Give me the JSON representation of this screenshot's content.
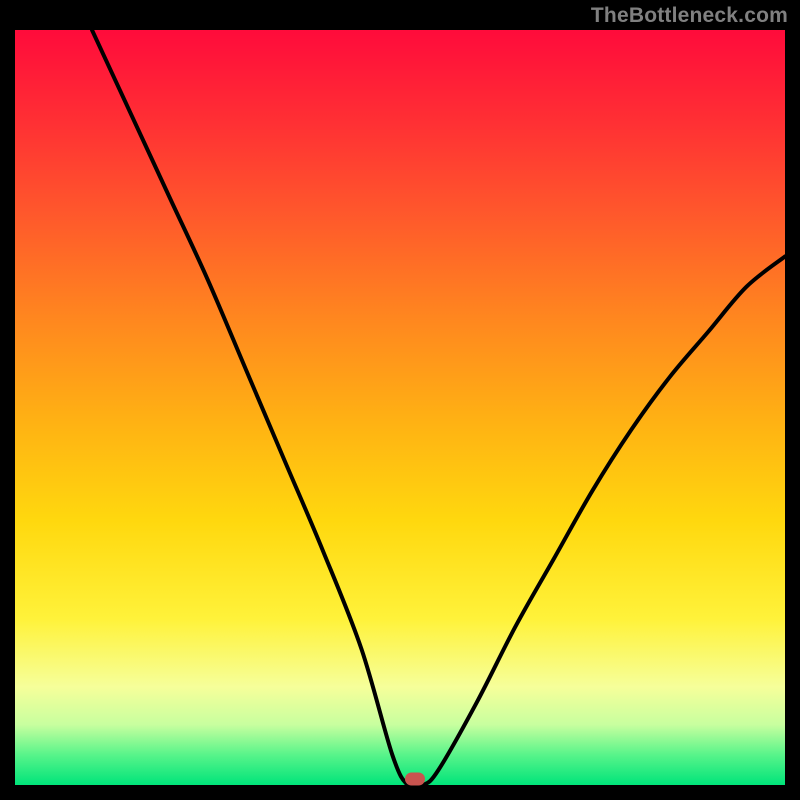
{
  "attribution": "TheBottleneck.com",
  "colors": {
    "background": "#000000",
    "gradient_top": "#ff0b3b",
    "gradient_bottom": "#00e47a",
    "curve": "#000000",
    "marker": "#c9544f",
    "attribution_text": "#808080"
  },
  "chart_data": {
    "type": "line",
    "title": "",
    "xlabel": "",
    "ylabel": "",
    "xlim": [
      0,
      100
    ],
    "ylim": [
      0,
      100
    ],
    "annotations": [
      {
        "kind": "marker",
        "x": 52,
        "y": 0,
        "shape": "rounded-rect",
        "color": "#c9544f"
      }
    ],
    "series": [
      {
        "name": "curve",
        "x": [
          10,
          15,
          20,
          25,
          30,
          35,
          40,
          45,
          49,
          51,
          53,
          55,
          60,
          65,
          70,
          75,
          80,
          85,
          90,
          95,
          100
        ],
        "values": [
          100,
          89,
          78,
          67,
          55,
          43,
          31,
          18,
          4,
          0,
          0,
          2,
          11,
          21,
          30,
          39,
          47,
          54,
          60,
          66,
          70
        ]
      }
    ],
    "min_point": {
      "x": 52,
      "y": 0
    }
  }
}
